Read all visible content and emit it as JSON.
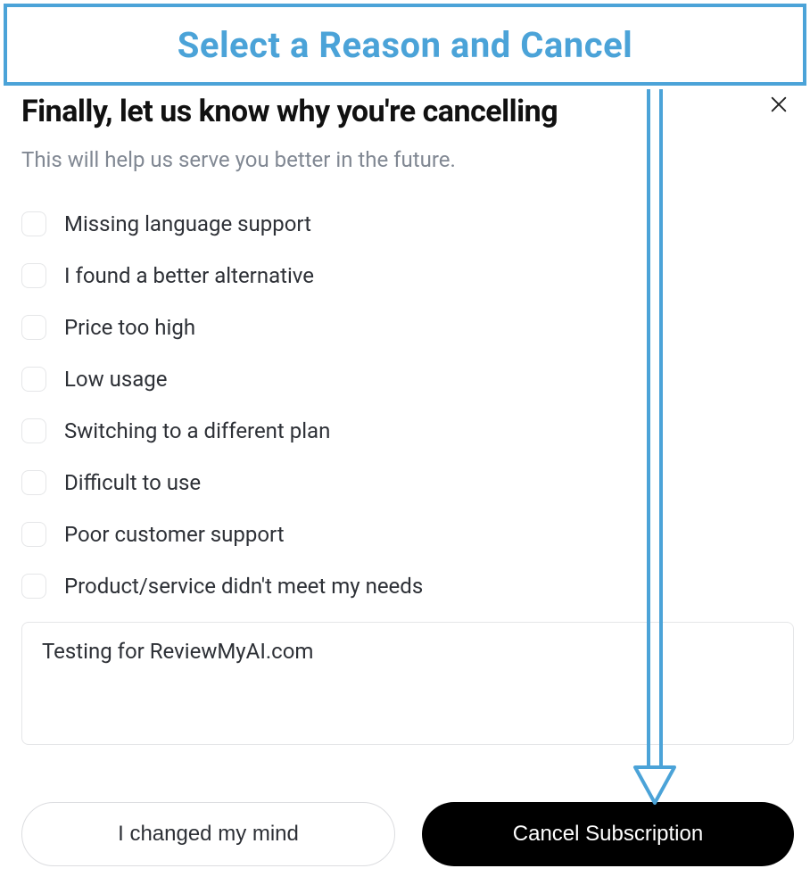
{
  "annotation": {
    "banner_text": "Select a Reason and Cancel"
  },
  "dialog": {
    "title": "Finally, let us know why you're cancelling",
    "subtitle": "This will help us serve you better in the future.",
    "reasons": [
      "Missing language support",
      "I found a better alternative",
      "Price too high",
      "Low usage",
      "Switching to a different plan",
      "Difficult to use",
      "Poor customer support",
      "Product/service didn't meet my needs"
    ],
    "feedback_value": "Testing for ReviewMyAI.com",
    "buttons": {
      "secondary": "I changed my mind",
      "primary": "Cancel Subscription"
    }
  }
}
